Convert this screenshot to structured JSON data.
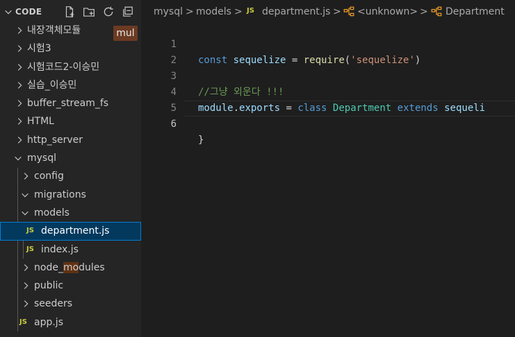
{
  "explorer": {
    "section_title": "CODE",
    "actions": {
      "new_file": "new-file-icon",
      "new_folder": "new-folder-icon",
      "refresh": "refresh-icon",
      "collapse": "collapse-all-icon"
    },
    "tooltip": "mul",
    "items": [
      {
        "label": "내장객체모듈",
        "type": "folder"
      },
      {
        "label": "시험3",
        "type": "folder"
      },
      {
        "label": "시험코드2-이승민",
        "type": "folder"
      },
      {
        "label": "실습_이승민",
        "type": "folder"
      },
      {
        "label": "buffer_stream_fs",
        "type": "folder"
      },
      {
        "label": "HTML",
        "type": "folder"
      },
      {
        "label": "http_server",
        "type": "folder"
      },
      {
        "label": "mysql",
        "type": "folder-open"
      },
      {
        "label": "config",
        "type": "folder"
      },
      {
        "label": "migrations",
        "type": "folder-open"
      },
      {
        "label": "models",
        "type": "folder-open"
      },
      {
        "label": "department.js",
        "type": "file-js",
        "selected": true
      },
      {
        "label": "index.js",
        "type": "file-js"
      },
      {
        "label": "node_modules",
        "type": "folder"
      },
      {
        "label": "public",
        "type": "folder"
      },
      {
        "label": "seeders",
        "type": "folder"
      },
      {
        "label": "app.js",
        "type": "file-js"
      }
    ],
    "node_modules_parts": [
      "node_",
      "mo",
      "dules"
    ],
    "js_badge": "JS"
  },
  "breadcrumb": {
    "folder1": "mysql",
    "folder2": "models",
    "file": "department.js",
    "symbol1": "<unknown>",
    "symbol2": "Department",
    "sep": ">"
  },
  "editor": {
    "line_numbers": [
      "1",
      "2",
      "3",
      "4",
      "5",
      "6"
    ],
    "line1": {
      "kw": "const",
      "var": "sequelize",
      "eq": " = ",
      "fn": "require",
      "open": "(",
      "str": "'sequelize'",
      "close": ")"
    },
    "line3": {
      "comment": "//그냥 외운다 !!!"
    },
    "line4": {
      "mod": "module",
      "dot": ".",
      "exp": "exports",
      "eq": " = ",
      "kw": "class",
      "cls": "Department",
      "ext": "extends",
      "var": "sequeli"
    },
    "line6": {
      "brace": "}"
    },
    "squiggle": "..."
  },
  "colors": {
    "sidebar_bg": "#252526",
    "editor_bg": "#1e1e1e",
    "selection_bg": "#04395e",
    "selection_border": "#007fd4",
    "js_icon": "#cbcb41"
  }
}
